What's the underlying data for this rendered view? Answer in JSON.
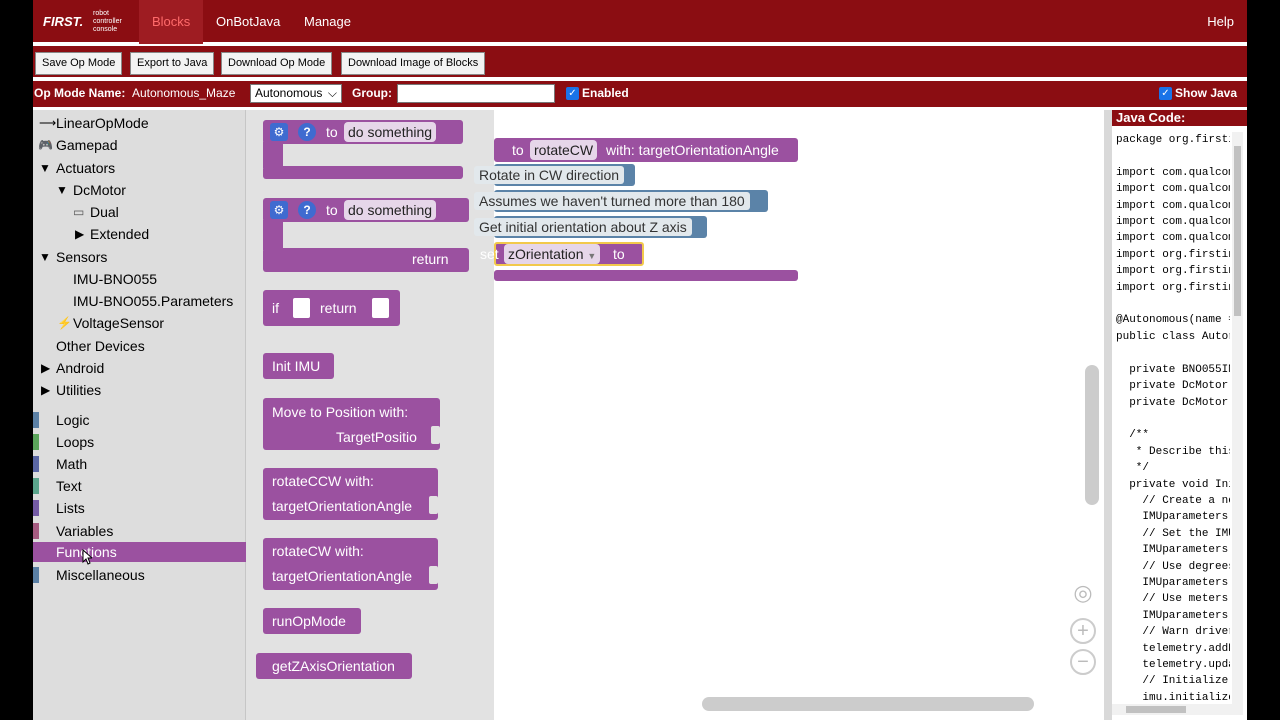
{
  "logo": {
    "first": "FIRST.",
    "sub": "robot\ncontroller\nconsole"
  },
  "nav": {
    "blocks": "Blocks",
    "onbotjava": "OnBotJava",
    "manage": "Manage",
    "help": "Help"
  },
  "toolbar": {
    "save": "Save Op Mode",
    "export": "Export to Java",
    "download": "Download Op Mode",
    "download_image": "Download Image of Blocks"
  },
  "opmode": {
    "name_label": "Op Mode Name:",
    "name_value": "Autonomous_Maze",
    "type_value": "Autonomous",
    "group_label": "Group:",
    "group_value": "",
    "enabled_label": "Enabled",
    "enabled": true,
    "show_java_label": "Show Java",
    "show_java": true
  },
  "tree": {
    "linear": "LinearOpMode",
    "gamepad": "Gamepad",
    "actuators": "Actuators",
    "dcmotor": "DcMotor",
    "dual": "Dual",
    "extended": "Extended",
    "sensors": "Sensors",
    "imu": "IMU-BNO055",
    "imu_params": "IMU-BNO055.Parameters",
    "voltage": "VoltageSensor",
    "other": "Other Devices",
    "android": "Android",
    "utilities": "Utilities",
    "categories": [
      {
        "label": "Logic",
        "color": "#5b80a5"
      },
      {
        "label": "Loops",
        "color": "#5ba55b"
      },
      {
        "label": "Math",
        "color": "#5b67a5"
      },
      {
        "label": "Text",
        "color": "#5ba58c"
      },
      {
        "label": "Lists",
        "color": "#745ba5"
      },
      {
        "label": "Variables",
        "color": "#a55b80"
      },
      {
        "label": "Functions",
        "color": "#9b51a0"
      },
      {
        "label": "Miscellaneous",
        "color": "#5b80a5"
      }
    ]
  },
  "flyout": {
    "to": "to",
    "do_something": "do something",
    "return": "return",
    "if": "if",
    "init_imu": "Init IMU",
    "move_to": "Move to Position  with:",
    "target_pos": "TargetPositio",
    "rotate_ccw": "rotateCCW  with:",
    "rotate_cw": "rotateCW  with:",
    "target_angle": "targetOrientationAngle",
    "run_op_mode": "runOpMode",
    "get_z": "getZAxisOrientation"
  },
  "workspace": {
    "func_to": "to",
    "func_name": "rotateCW",
    "func_with": "with: targetOrientationAngle",
    "comment1": "Rotate in CW direction",
    "comment2": "Assumes we haven't turned more than 180",
    "comment3": "Get initial orientation about Z axis",
    "set": "set",
    "var_name": "zOrientation",
    "set_to": "to"
  },
  "java": {
    "title": "Java Code:",
    "code": "package org.firsti\n\nimport com.qualcom\nimport com.qualcom\nimport com.qualcom\nimport com.qualcom\nimport com.qualcom\nimport org.firstin\nimport org.firstin\nimport org.firstin\n\n@Autonomous(name =\npublic class Autor\n\n  private BNO055IM\n  private DcMotor\n  private DcMotor\n\n  /**\n   * Describe this\n   */\n  private void Ini\n    // Create a ne\n    IMUparameters\n    // Set the IMU\n    IMUparameters.\n    // Use degrees\n    IMUparameters.\n    // Use meters\n    IMUparameters.\n    // Warn driver\n    telemetry.addD\n    telemetry.upda\n    // Initialize\n    imu.initialize"
  }
}
